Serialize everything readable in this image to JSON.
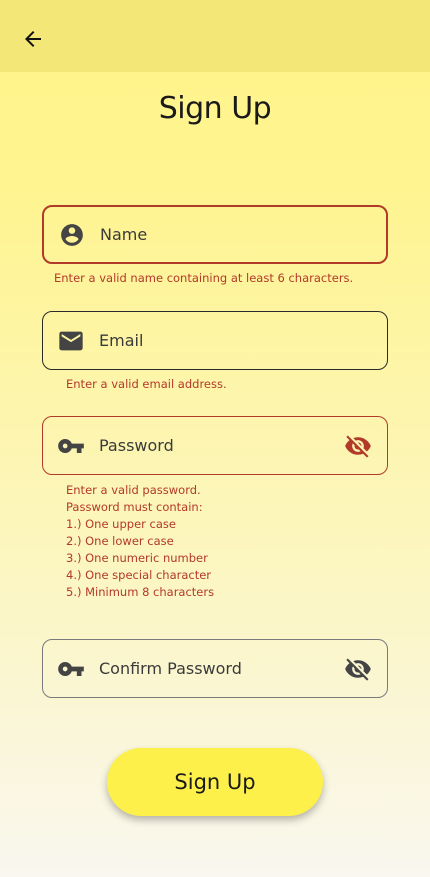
{
  "page": {
    "title": "Sign Up"
  },
  "icons": {
    "back": "arrow-left-icon",
    "name": "account-circle-icon",
    "email": "envelope-icon",
    "password": "key-icon",
    "visibility": "eye-off-icon"
  },
  "colors": {
    "error": "#b23a28",
    "button": "#fdf04a",
    "appbar": "#f3e778"
  },
  "form": {
    "name": {
      "label": "Name",
      "error": "Enter a valid name containing at least 6 characters."
    },
    "email": {
      "label": "Email",
      "error": "Enter a valid email address."
    },
    "password": {
      "label": "Password",
      "error_lines": [
        "Enter a valid password.",
        "Password must contain:",
        "1.) One upper case",
        "2.) One lower case",
        "3.) One numeric number",
        "4.) One special character",
        "5.) Minimum 8 characters"
      ]
    },
    "confirm_password": {
      "label": "Confirm Password"
    }
  },
  "submit": {
    "label": "Sign Up"
  }
}
